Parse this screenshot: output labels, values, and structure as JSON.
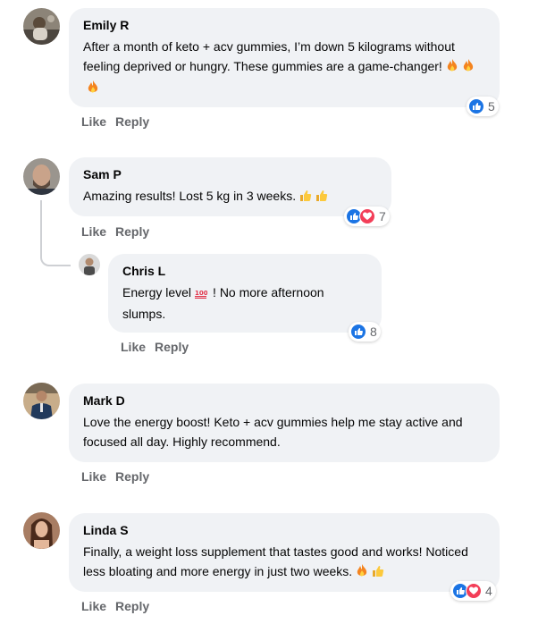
{
  "actions": {
    "like_label": "Like",
    "reply_label": "Reply"
  },
  "colors": {
    "bubble": "#f0f2f5",
    "like_blue": "#1b74e4",
    "love_red": "#f33e58",
    "meta_gray": "#65676b"
  },
  "comments": [
    {
      "author": "Emily R",
      "text": "After a month of keto + acv gummies, I’m down 5 kilograms without feeling deprived or hungry. These gummies are a game-changer!",
      "emojis": [
        "fire-emoji",
        "fire-emoji",
        "fire-emoji"
      ],
      "reactions": [
        "like"
      ],
      "reaction_count": "5"
    },
    {
      "author": "Sam P",
      "text": "Amazing results! Lost 5 kg in 3 weeks.",
      "emojis": [
        "thumbs-up-emoji",
        "thumbs-up-emoji"
      ],
      "reactions": [
        "like",
        "love"
      ],
      "reaction_count": "7"
    },
    {
      "author": "Chris L",
      "text_before": "Energy level",
      "text_after": "! No more afternoon slumps.",
      "emojis": [
        "hundred-points-emoji"
      ],
      "reactions": [
        "like"
      ],
      "reaction_count": "8"
    },
    {
      "author": "Mark D",
      "text": "Love the energy boost! Keto + acv gummies help me stay active and focused all day. Highly recommend.",
      "emojis": [],
      "reactions": [],
      "reaction_count": ""
    },
    {
      "author": "Linda S",
      "text": "Finally, a weight loss supplement that tastes good and works! Noticed less bloating and more energy in just two weeks.",
      "emojis": [
        "fire-emoji",
        "thumbs-up-emoji"
      ],
      "reactions": [
        "like",
        "love"
      ],
      "reaction_count": "4"
    }
  ]
}
